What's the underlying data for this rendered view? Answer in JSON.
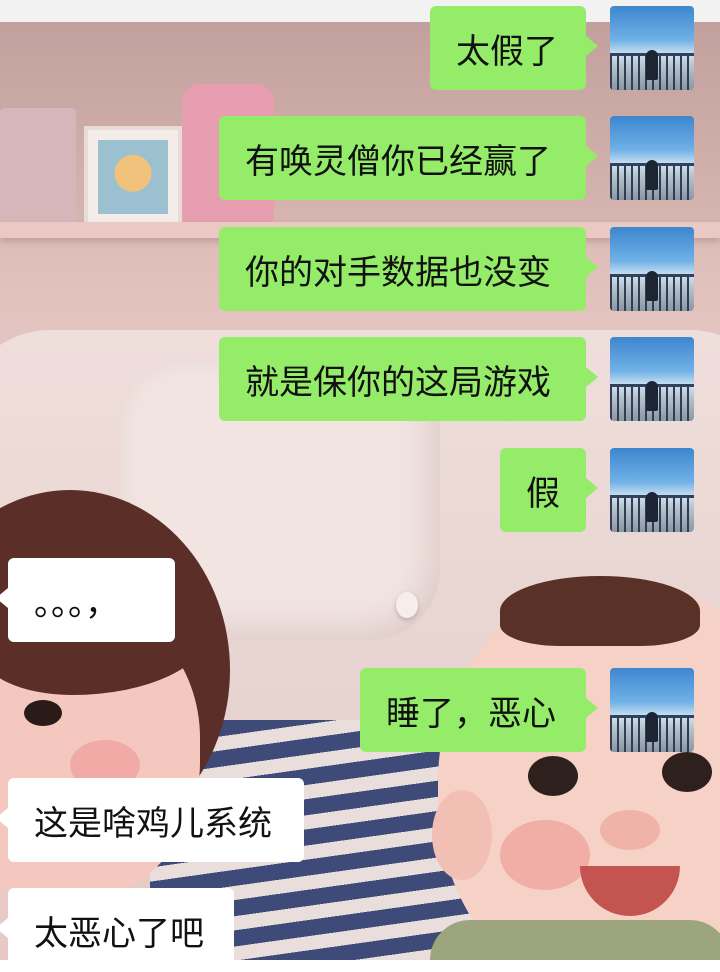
{
  "messages": [
    {
      "side": "me",
      "text": "太假了"
    },
    {
      "side": "me",
      "text": "有唤灵僧你已经赢了"
    },
    {
      "side": "me",
      "text": "你的对手数据也没变"
    },
    {
      "side": "me",
      "text": "就是保你的这局游戏"
    },
    {
      "side": "me",
      "text": "假"
    },
    {
      "side": "them",
      "text": "。。。，"
    },
    {
      "side": "me",
      "text": "睡了，恶心"
    },
    {
      "side": "them",
      "text": "这是啥鸡儿系统"
    },
    {
      "side": "them",
      "text": "太恶心了吧"
    }
  ],
  "colors": {
    "my_bubble": "#95ec69",
    "their_bubble": "#ffffff"
  }
}
